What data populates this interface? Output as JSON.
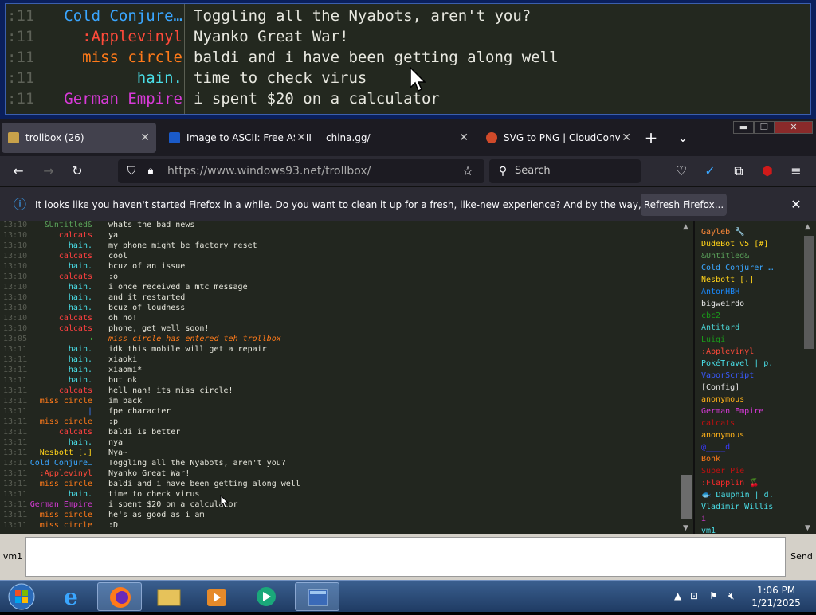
{
  "zoom": {
    "rows": [
      {
        "time": ":11",
        "name": "Cold Conjure…",
        "color": "#3aa6ff",
        "msg": "Toggling all the Nyabots, aren't you?"
      },
      {
        "time": ":11",
        "name": ":Applevinyl",
        "color": "#ff4a3a",
        "msg": "Nyanko Great War!"
      },
      {
        "time": ":11",
        "name": "miss circle",
        "color": "#ff7a1a",
        "msg": "baldi and i have been getting along well"
      },
      {
        "time": ":11",
        "name": "hain.",
        "color": "#4adfe8",
        "msg": "time to check virus"
      },
      {
        "time": ":11",
        "name": "German Empire",
        "color": "#d83ad8",
        "msg": "i spent $20 on a calculator"
      }
    ]
  },
  "tabs": [
    {
      "label": "trollbox (26)",
      "close": "✕"
    },
    {
      "label": "Image to ASCII: Free ASCII",
      "close": "✕"
    },
    {
      "label": "china.gg/",
      "close": "✕"
    },
    {
      "label": "SVG to PNG | CloudConver",
      "close": "✕"
    }
  ],
  "tabbar": {
    "new_tab": "+",
    "list_tabs": "⌄"
  },
  "window": {
    "minimize": "▬",
    "maximize": "❐",
    "close": "✕"
  },
  "nav": {
    "url": "https://www.windows93.net/trollbox/",
    "search_placeholder": "Search"
  },
  "notification": {
    "text": "It looks like you haven't started Firefox in a while. Do you want to clean it up for a fresh, like-new experience? And by the way, welcome back!",
    "button": "Refresh Firefox...",
    "close": "✕"
  },
  "chat": [
    {
      "time": "13:10",
      "name": "&Untitled&",
      "color": "#5aa05a",
      "msg": "whats the bad news"
    },
    {
      "time": "13:10",
      "name": "calcats",
      "color": "#ff4040",
      "msg": "ya"
    },
    {
      "time": "13:10",
      "name": "hain.",
      "color": "#4adfe8",
      "msg": "my phone might be factory reset"
    },
    {
      "time": "13:10",
      "name": "calcats",
      "color": "#ff4040",
      "msg": "cool"
    },
    {
      "time": "13:10",
      "name": "hain.",
      "color": "#4adfe8",
      "msg": "bcuz of an issue"
    },
    {
      "time": "13:10",
      "name": "calcats",
      "color": "#ff4040",
      "msg": ":o"
    },
    {
      "time": "13:10",
      "name": "hain.",
      "color": "#4adfe8",
      "msg": "i once received a mtc message"
    },
    {
      "time": "13:10",
      "name": "hain.",
      "color": "#4adfe8",
      "msg": "and it restarted"
    },
    {
      "time": "13:10",
      "name": "hain.",
      "color": "#4adfe8",
      "msg": "bcuz of loudness"
    },
    {
      "time": "13:10",
      "name": "calcats",
      "color": "#ff4040",
      "msg": "oh no!"
    },
    {
      "time": "13:10",
      "name": "calcats",
      "color": "#ff4040",
      "msg": "phone, get well soon!"
    },
    {
      "time": "13:05",
      "name": "→",
      "color": "#4adf4a",
      "msg": "miss circle has entered teh trollbox",
      "sys": true
    },
    {
      "time": "13:11",
      "name": "hain.",
      "color": "#4adfe8",
      "msg": "idk this mobile will get a repair"
    },
    {
      "time": "13:11",
      "name": "hain.",
      "color": "#4adfe8",
      "msg": "xiaoki"
    },
    {
      "time": "13:11",
      "name": "hain.",
      "color": "#4adfe8",
      "msg": "xiaomi*"
    },
    {
      "time": "13:11",
      "name": "hain.",
      "color": "#4adfe8",
      "msg": "but ok"
    },
    {
      "time": "13:11",
      "name": "calcats",
      "color": "#ff4040",
      "msg": "hell nah! its miss circle!"
    },
    {
      "time": "13:11",
      "name": "miss circle",
      "color": "#ff7a1a",
      "msg": "im back"
    },
    {
      "time": "13:11",
      "name": "|",
      "color": "#3a7aff",
      "msg": "fpe character"
    },
    {
      "time": "13:11",
      "name": "miss circle",
      "color": "#ff7a1a",
      "msg": ":p"
    },
    {
      "time": "13:11",
      "name": "calcats",
      "color": "#ff4040",
      "msg": "baldi is better"
    },
    {
      "time": "13:11",
      "name": "hain.",
      "color": "#4adfe8",
      "msg": "nya"
    },
    {
      "time": "13:11",
      "name": "Nesbott [.]",
      "color": "#ffd21a",
      "msg": "Nya~"
    },
    {
      "time": "13:11",
      "name": "Cold Conjure…",
      "color": "#3aa6ff",
      "msg": "Toggling all the Nyabots, aren't you?"
    },
    {
      "time": "13:11",
      "name": ":Applevinyl",
      "color": "#ff4a3a",
      "msg": "Nyanko Great War!"
    },
    {
      "time": "13:11",
      "name": "miss circle",
      "color": "#ff7a1a",
      "msg": "baldi and i have been getting along well"
    },
    {
      "time": "13:11",
      "name": "hain.",
      "color": "#4adfe8",
      "msg": "time to check virus"
    },
    {
      "time": "13:11",
      "name": "German Empire",
      "color": "#d83ad8",
      "msg": "i spent $20 on a calculator"
    },
    {
      "time": "13:11",
      "name": "miss circle",
      "color": "#ff7a1a",
      "msg": "he's as good as i am"
    },
    {
      "time": "13:11",
      "name": "miss circle",
      "color": "#ff7a1a",
      "msg": ":D"
    }
  ],
  "users": [
    {
      "name": "Gayleb 🔧",
      "color": "#ff8a3a"
    },
    {
      "name": "DudeBot v5 [#]",
      "color": "#ffd21a"
    },
    {
      "name": "&Untitled&",
      "color": "#5aa05a"
    },
    {
      "name": "Cold Conjurer …",
      "color": "#3aa6ff"
    },
    {
      "name": "Nesbott [.]",
      "color": "#ffd21a"
    },
    {
      "name": "AntonHBH",
      "color": "#1a8aff"
    },
    {
      "name": "bigweirdo",
      "color": "#e6e6e6"
    },
    {
      "name": "cbc2",
      "color": "#1a9a1a"
    },
    {
      "name": "Antitard",
      "color": "#4ad0d0"
    },
    {
      "name": "Luigi",
      "color": "#1a9a1a"
    },
    {
      "name": ":Applevinyl",
      "color": "#ff4a3a"
    },
    {
      "name": "PokéTravel | p.",
      "color": "#4adfe8"
    },
    {
      "name": "VaporScript",
      "color": "#3a5aff"
    },
    {
      "name": "[Config]",
      "color": "#e6e6e6"
    },
    {
      "name": "anonymous",
      "color": "#ffb21a"
    },
    {
      "name": "German Empire",
      "color": "#d83ad8"
    },
    {
      "name": "calcats",
      "color": "#c01010"
    },
    {
      "name": "anonymous",
      "color": "#ffb21a"
    },
    {
      "name": "@____d",
      "color": "#3a3aff"
    },
    {
      "name": "Bonk",
      "color": "#ff7a1a"
    },
    {
      "name": "Super Pie",
      "color": "#c01010"
    },
    {
      "name": ":Flapplin 🍒",
      "color": "#ff2a2a"
    },
    {
      "name": "🐟 Dauphin | d.",
      "color": "#4adfe8"
    },
    {
      "name": "Vladimir Willis",
      "color": "#4adfe8"
    },
    {
      "name": "i",
      "color": "#d83ad8"
    },
    {
      "name": "vm1",
      "color": "#4adfe8"
    }
  ],
  "input": {
    "nick": "vm1",
    "send": "Send"
  },
  "taskbar": {
    "time": "1:06 PM",
    "date": "1/21/2025"
  }
}
